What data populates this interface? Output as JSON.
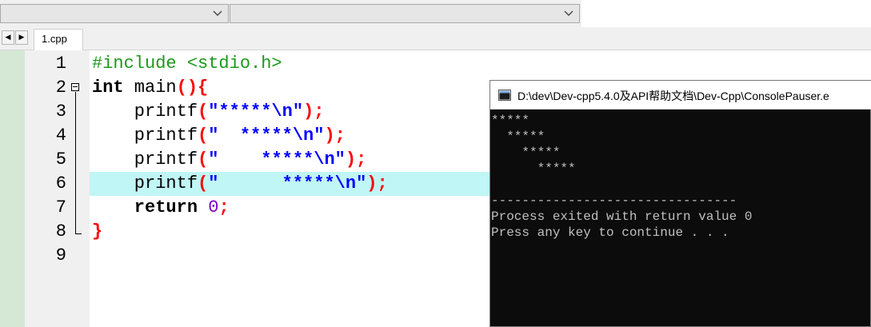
{
  "toolbar": {
    "combo1_value": "",
    "combo2_value": ""
  },
  "tabs": [
    {
      "label": "1.cpp",
      "active": true
    }
  ],
  "editor": {
    "highlight_line": 6,
    "lines": [
      {
        "num": "1",
        "tokens": [
          {
            "t": "#include <stdio.h>",
            "c": "kw-pre"
          }
        ]
      },
      {
        "num": "2",
        "tokens": [
          {
            "t": "int",
            "c": "kw"
          },
          {
            "t": " main",
            "c": "fn"
          },
          {
            "t": "(){",
            "c": "sym"
          }
        ]
      },
      {
        "num": "3",
        "tokens": [
          {
            "t": "    printf",
            "c": "fn"
          },
          {
            "t": "(",
            "c": "sym"
          },
          {
            "t": "\"*****\\n\"",
            "c": "str"
          },
          {
            "t": ");",
            "c": "sym"
          }
        ]
      },
      {
        "num": "4",
        "tokens": [
          {
            "t": "    printf",
            "c": "fn"
          },
          {
            "t": "(",
            "c": "sym"
          },
          {
            "t": "\"  *****\\n\"",
            "c": "str"
          },
          {
            "t": ");",
            "c": "sym"
          }
        ]
      },
      {
        "num": "5",
        "tokens": [
          {
            "t": "    printf",
            "c": "fn"
          },
          {
            "t": "(",
            "c": "sym"
          },
          {
            "t": "\"    *****\\n\"",
            "c": "str"
          },
          {
            "t": ");",
            "c": "sym"
          }
        ]
      },
      {
        "num": "6",
        "tokens": [
          {
            "t": "    printf",
            "c": "fn"
          },
          {
            "t": "(",
            "c": "sym"
          },
          {
            "t": "\"      *****\\n\"",
            "c": "str"
          },
          {
            "t": ");",
            "c": "sym"
          }
        ]
      },
      {
        "num": "7",
        "tokens": [
          {
            "t": "    return",
            "c": "kw"
          },
          {
            "t": " 0",
            "c": "num"
          },
          {
            "t": ";",
            "c": "sym"
          }
        ]
      },
      {
        "num": "8",
        "tokens": [
          {
            "t": "}",
            "c": "sym"
          }
        ]
      },
      {
        "num": "9",
        "tokens": []
      }
    ]
  },
  "console": {
    "title": "D:\\dev\\Dev-cpp5.4.0及API帮助文档\\Dev-Cpp\\ConsolePauser.e",
    "lines": [
      "*****",
      "  *****",
      "    *****",
      "      *****",
      "",
      "--------------------------------",
      "Process exited with return value 0",
      "Press any key to continue . . ."
    ]
  },
  "colors": {
    "preprocessor": "#1a9a1a",
    "string": "#0000ff",
    "symbol": "#ff0000",
    "number": "#8000c0",
    "current_line": "#c0f6f6",
    "console_bg": "#0c0c0c",
    "console_text": "#c0c0c0"
  },
  "icons": {
    "combo_arrow": "chevron-down-icon",
    "scroll_left": "scroll-left-icon",
    "scroll_right": "scroll-right-icon",
    "console_app": "console-window-icon",
    "fold": "fold-collapse-icon"
  }
}
